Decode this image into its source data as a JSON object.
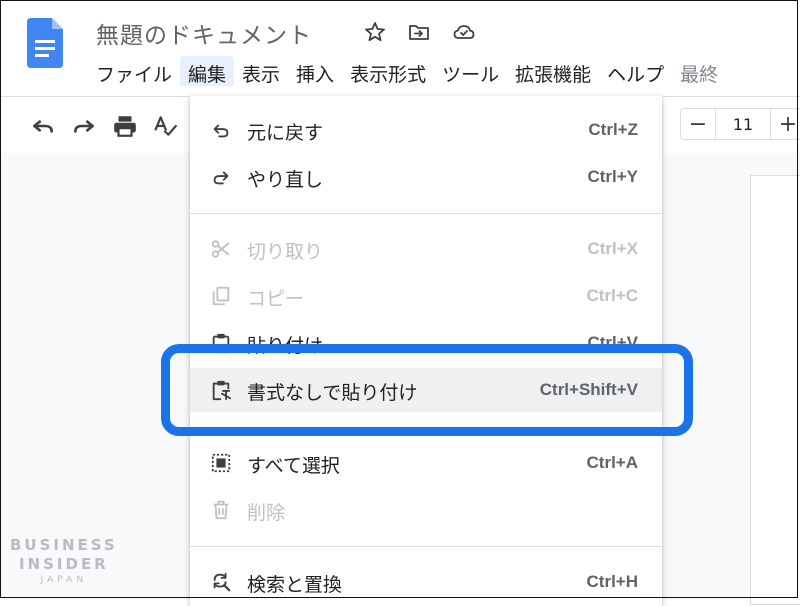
{
  "document": {
    "title": "無題のドキュメント"
  },
  "menubar": {
    "items": [
      "ファイル",
      "編集",
      "表示",
      "挿入",
      "表示形式",
      "ツール",
      "拡張機能",
      "ヘルプ",
      "最終"
    ],
    "active_index": 1
  },
  "toolbar": {
    "font_size": "11",
    "minus": "−",
    "plus": "+"
  },
  "edit_menu": {
    "items": [
      {
        "label": "元に戻す",
        "shortcut": "Ctrl+Z",
        "icon": "undo-icon",
        "enabled": true
      },
      {
        "label": "やり直し",
        "shortcut": "Ctrl+Y",
        "icon": "redo-icon",
        "enabled": true
      },
      {
        "label": "切り取り",
        "shortcut": "Ctrl+X",
        "icon": "scissors-icon",
        "enabled": false
      },
      {
        "label": "コピー",
        "shortcut": "Ctrl+C",
        "icon": "copy-icon",
        "enabled": false
      },
      {
        "label": "貼り付け",
        "shortcut": "Ctrl+V",
        "icon": "clipboard-icon",
        "enabled": true
      },
      {
        "label": "書式なしで貼り付け",
        "shortcut": "Ctrl+Shift+V",
        "icon": "paste-plain-icon",
        "enabled": true,
        "highlighted": true
      },
      {
        "label": "すべて選択",
        "shortcut": "Ctrl+A",
        "icon": "select-all-icon",
        "enabled": true
      },
      {
        "label": "削除",
        "shortcut": "",
        "icon": "trash-icon",
        "enabled": false
      },
      {
        "label": "検索と置換",
        "shortcut": "Ctrl+H",
        "icon": "find-replace-icon",
        "enabled": true
      }
    ]
  },
  "watermark": {
    "line1": "BUSINESS",
    "line2": "INSIDER",
    "line3": "JAPAN"
  },
  "colors": {
    "accent": "#1a73e8",
    "docs_blue": "#4285f4",
    "highlight_row": "#eef0f2",
    "disabled_text": "#bdc1c6"
  }
}
